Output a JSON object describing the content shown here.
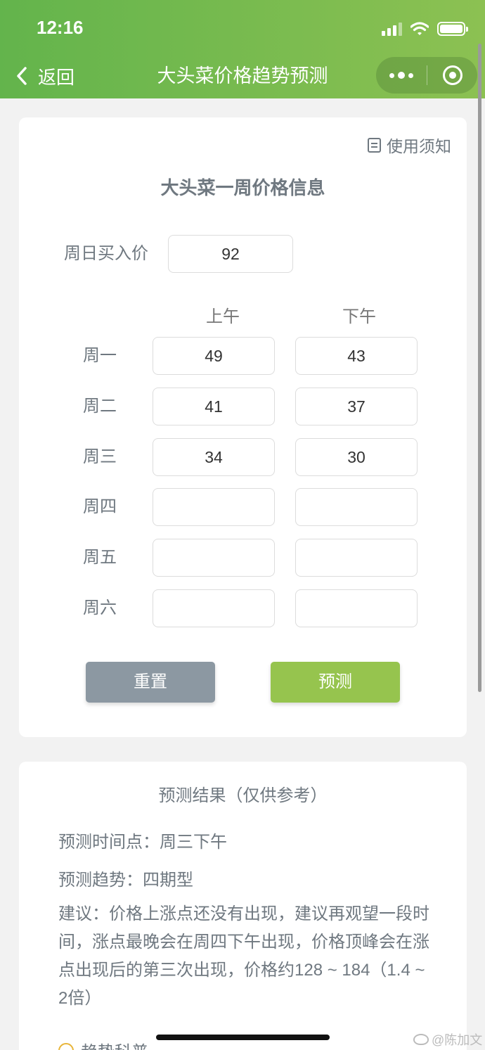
{
  "status_bar": {
    "time": "12:16"
  },
  "nav": {
    "back_label": "返回",
    "title": "大头菜价格趋势预测"
  },
  "card": {
    "notice_label": "使用须知",
    "title": "大头菜一周价格信息",
    "sunday_label": "周日买入价",
    "sunday_value": "92",
    "col_am": "上午",
    "col_pm": "下午",
    "rows": [
      {
        "day": "周一",
        "am": "49",
        "pm": "43"
      },
      {
        "day": "周二",
        "am": "41",
        "pm": "37"
      },
      {
        "day": "周三",
        "am": "34",
        "pm": "30"
      },
      {
        "day": "周四",
        "am": "",
        "pm": ""
      },
      {
        "day": "周五",
        "am": "",
        "pm": ""
      },
      {
        "day": "周六",
        "am": "",
        "pm": ""
      }
    ],
    "reset_label": "重置",
    "predict_label": "预测"
  },
  "result": {
    "title": "预测结果（仅供参考）",
    "time_point": "预测时间点：周三下午",
    "trend": "预测趋势：四期型",
    "advice": "建议：价格上涨点还没有出现，建议再观望一段时间，涨点最晚会在周四下午出现，价格顶峰会在涨点出现后的第三次出现，价格约128 ~ 184（1.4 ~ 2倍）",
    "extra_label": "趋势科普"
  },
  "watermark": "@陈加文",
  "colors": {
    "header_start": "#63b44c",
    "header_end": "#8cc152",
    "predict_button": "#96c44e",
    "reset_button": "#8c98a2"
  }
}
